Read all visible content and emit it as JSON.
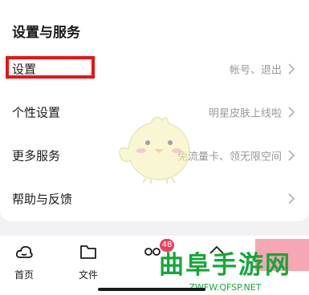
{
  "section_title": "设置与服务",
  "rows": [
    {
      "label": "设置",
      "hint": "帐号、退出"
    },
    {
      "label": "个性设置",
      "hint": "明星皮肤上线啦"
    },
    {
      "label": "更多服务",
      "hint": "免流量卡、领无限空间"
    },
    {
      "label": "帮助与反馈",
      "hint": ""
    }
  ],
  "tabbar": {
    "tabs": [
      {
        "label": "首页",
        "icon": "cloud-icon"
      },
      {
        "label": "文件",
        "icon": "folder-icon"
      },
      {
        "label": "",
        "icon": "share-icon"
      },
      {
        "label": "",
        "icon": "up-arrow-icon"
      }
    ],
    "badge": "48"
  },
  "watermark": {
    "text": "曲阜手游网",
    "url": "ZWFW.QFSP.NET"
  },
  "colors": {
    "highlight": "#ee1111",
    "badge": "#f03d5c",
    "watermark": "#14a83a"
  }
}
